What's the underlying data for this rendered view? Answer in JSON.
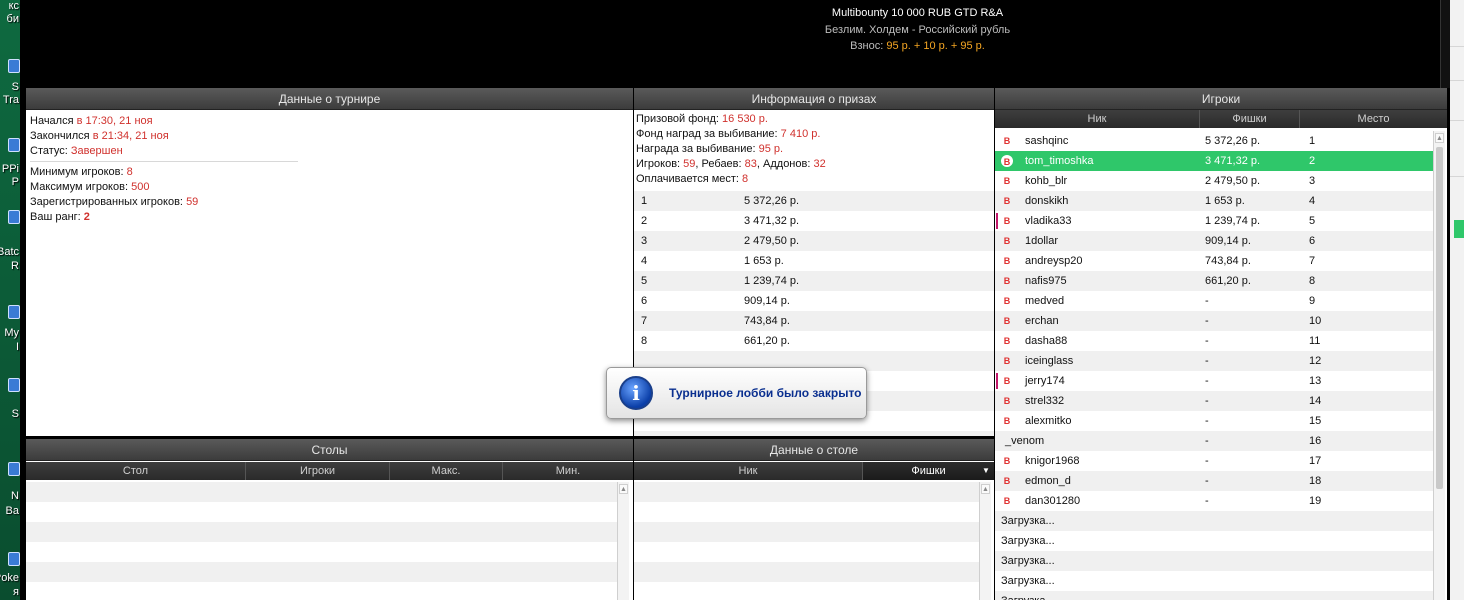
{
  "desktop": {
    "items": [
      {
        "text": "кс",
        "text2": "би"
      },
      {
        "text": "S",
        "text2": "Tra"
      },
      {
        "text": "PPi",
        "text2": "P"
      },
      {
        "text": "Batc",
        "text2": "R"
      },
      {
        "text": "My ",
        "text2": "I"
      },
      {
        "text": "S",
        "text2": ""
      },
      {
        "text": "N",
        "text2": "Ba"
      },
      {
        "text": "Poke",
        "text2": "я"
      }
    ]
  },
  "header": {
    "title": "Multibounty 10 000 RUB GTD R&A",
    "game": "Безлим. Холдем - Российский рубль",
    "buyin_label": "Взнос:",
    "buyin_value": "95 р. + 10 р. + 95 р."
  },
  "tournament": {
    "title": "Данные о турнире",
    "started_label": "Начался",
    "started_value": "в 17:30, 21 ноя",
    "ended_label": "Закончился",
    "ended_value": "в 21:34, 21 ноя",
    "status_label": "Статус:",
    "status_value": "Завершен",
    "min_label": "Минимум игроков:",
    "min_value": "8",
    "max_label": "Максимум игроков:",
    "max_value": "500",
    "reg_label": "Зарегистрированных игроков:",
    "reg_value": "59",
    "rank_label": "Ваш ранг:",
    "rank_value": "2"
  },
  "prizes": {
    "title": "Информация о призах",
    "pool_label": "Призовой фонд:",
    "pool_value": "16 530 р.",
    "bounty_fund_label": "Фонд наград за выбивание:",
    "bounty_fund_value": "7 410 р.",
    "bounty_label": "Награда за выбивание:",
    "bounty_value": "95 р.",
    "players_label": "Игроков:",
    "players_value": "59",
    "rebuys_label": "Ребаев:",
    "rebuys_value": "83",
    "addons_label": "Аддонов:",
    "addons_value": "32",
    "paid_label": "Оплачивается мест:",
    "paid_value": "8",
    "rows": [
      {
        "place": "1",
        "amount": "5 372,26 р."
      },
      {
        "place": "2",
        "amount": "3 471,32 р."
      },
      {
        "place": "3",
        "amount": "2 479,50 р."
      },
      {
        "place": "4",
        "amount": "1 653 р."
      },
      {
        "place": "5",
        "amount": "1 239,74 р."
      },
      {
        "place": "6",
        "amount": "909,14 р."
      },
      {
        "place": "7",
        "amount": "743,84 р."
      },
      {
        "place": "8",
        "amount": "661,20 р."
      }
    ]
  },
  "players": {
    "title": "Игроки",
    "col_nick": "Ник",
    "col_chips": "Фишки",
    "col_place": "Место",
    "badge": "B",
    "rows": [
      {
        "nick": "sashqinc",
        "chips": "5 372,26 р.",
        "place": "1"
      },
      {
        "nick": "tom_timoshka",
        "chips": "3 471,32 р.",
        "place": "2"
      },
      {
        "nick": "kohb_blr",
        "chips": "2 479,50 р.",
        "place": "3"
      },
      {
        "nick": "donskikh",
        "chips": "1 653 р.",
        "place": "4"
      },
      {
        "nick": "vladika33",
        "chips": "1 239,74 р.",
        "place": "5"
      },
      {
        "nick": "1dollar",
        "chips": "909,14 р.",
        "place": "6"
      },
      {
        "nick": "andreysp20",
        "chips": "743,84 р.",
        "place": "7"
      },
      {
        "nick": "nafis975",
        "chips": "661,20 р.",
        "place": "8"
      },
      {
        "nick": "medved",
        "chips": "-",
        "place": "9"
      },
      {
        "nick": "erchan",
        "chips": "-",
        "place": "10"
      },
      {
        "nick": "dasha88",
        "chips": "-",
        "place": "11"
      },
      {
        "nick": "iceinglass",
        "chips": "-",
        "place": "12"
      },
      {
        "nick": "jerry174",
        "chips": "-",
        "place": "13"
      },
      {
        "nick": "strel332",
        "chips": "-",
        "place": "14"
      },
      {
        "nick": "alexmitko",
        "chips": "-",
        "place": "15"
      },
      {
        "nick": "_venom",
        "chips": "-",
        "place": "16"
      },
      {
        "nick": "knigor1968",
        "chips": "-",
        "place": "17"
      },
      {
        "nick": "edmon_d",
        "chips": "-",
        "place": "18"
      },
      {
        "nick": "dan301280",
        "chips": "-",
        "place": "19"
      }
    ],
    "loading": [
      "Загрузка...",
      "Загрузка...",
      "Загрузка...",
      "Загрузка...",
      "Загрузка..."
    ]
  },
  "tables": {
    "title": "Столы",
    "col_table": "Стол",
    "col_players": "Игроки",
    "col_max": "Макс.",
    "col_min": "Мин."
  },
  "table_data": {
    "title": "Данные о столе",
    "col_nick": "Ник",
    "col_chips": "Фишки",
    "sort_arrow": "▼"
  },
  "toast": {
    "message": "Турнирное лобби было закрыто",
    "icon_letter": "i"
  },
  "colors": {
    "accent_value": "#d0312d",
    "selected_row": "#2fc76a",
    "buyin": "#f5a623"
  }
}
